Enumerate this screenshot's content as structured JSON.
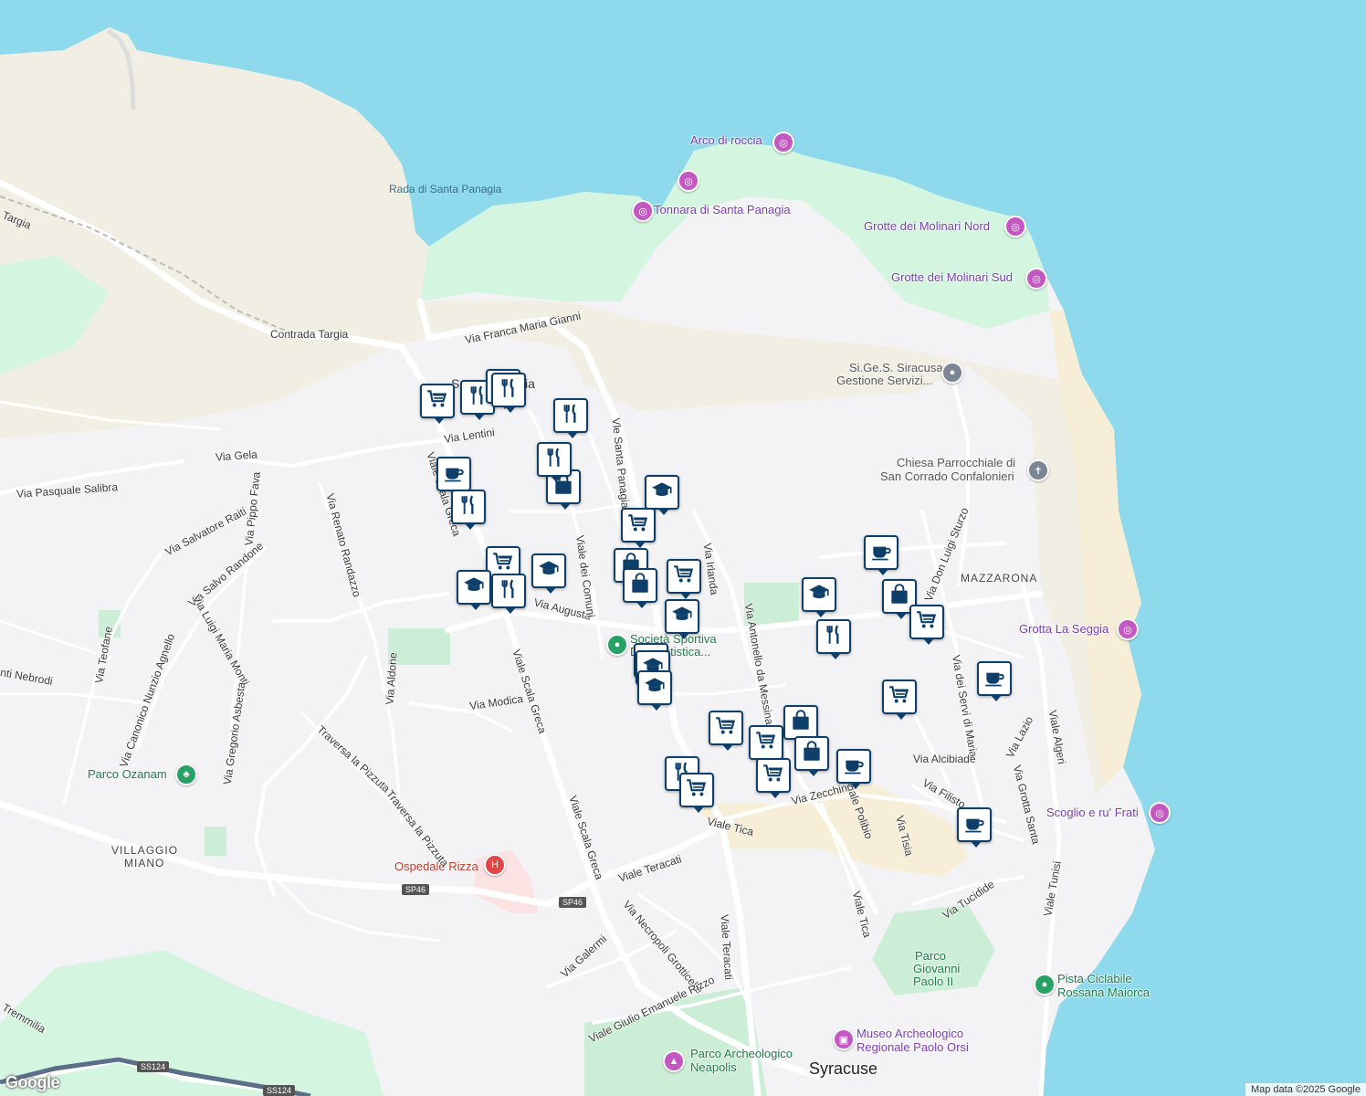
{
  "map": {
    "attribution": "Map data ©2025 Google",
    "logo": "Google",
    "colors": {
      "water": "#8fd9ec",
      "land": "#f3f3f5",
      "park": "#d4f5e0",
      "scrub": "#f1efe3",
      "beach": "#f6eed6",
      "marker_border": "#0d3f6a"
    }
  },
  "labels": {
    "water_rada": "Rada di Santa Panagia",
    "arco": "Arco di roccia",
    "tonnara": "Tonnara di Santa Panagia",
    "molinari_nord": "Grotte dei Molinari Nord",
    "molinari_sud": "Grotte dei Molinari Sud",
    "sigesa_1": "Si.Ge.S. Siracusana",
    "sigesa_2": "Gestione Servizi...",
    "chiesa_1": "Chiesa Parrocchiale di",
    "chiesa_2": "San Corrado Confalonieri",
    "mazzarona": "MAZZARONA",
    "grotta_seggia": "Grotta La Seggia",
    "scoglio": "Scoglio e ru' Frati",
    "pista_1": "Pista Ciclabile",
    "pista_2": "Rossana Maiorca",
    "parco_gp_1": "Parco",
    "parco_gp_2": "Giovanni",
    "parco_gp_3": "Paolo II",
    "museo_1": "Museo Archeologico",
    "museo_2": "Regionale Paolo Orsi",
    "parco_arch_1": "Parco Archeologico",
    "parco_arch_2": "Neapolis",
    "syracuse": "Syracuse",
    "parco_ozanam": "Parco Ozanam",
    "villaggio_1": "VILLAGGIO",
    "villaggio_2": "MIANO",
    "ospedale": "Ospedale Rizza",
    "societa_1": "Società Sportiva",
    "societa_2": "Dilettantistica...",
    "santa_panagia": "Santa Panagia",
    "sp46": "SP46",
    "ss124": "SS124",
    "targia": "Targia",
    "contrada_targia": "Contrada Targia",
    "via_franca": "Via Franca Maria Gianni",
    "via_lentini": "Via Lentini",
    "via_gela": "Via Gela",
    "via_pasquale": "Via Pasquale Salibra",
    "via_pippo": "Via Pippo Fava",
    "via_renato": "Via Renato Randazzo",
    "via_salvatore": "Via Salvatore Raiti",
    "via_salvo": "Via Salvo Randone",
    "via_luigi": "Via Luigi Maria Monti",
    "via_teofane": "Via Teofane",
    "via_nebrodi": "nti Nebrodi",
    "via_canonico": "Via Canonico Nunzio Agnello",
    "via_gregorio": "Via Gregorio Asbesta",
    "via_aldone": "Via Aldone",
    "via_modica": "Via Modica",
    "traversa_1": "Traversa la Pizzuta",
    "traversa_2": "Traversa la Pizzuta",
    "viale_scala": "Viale Scala Greca",
    "viale_scala_2": "Viale Scala Greca",
    "viale_teracati": "Viale Teracati",
    "viale_teracati_2": "Viale Teracati",
    "via_augusta": "Via Augusta",
    "viale_comuni": "Viale dei Comuni",
    "vle_santa": "Vle Santa Panagia",
    "via_irlanda": "Via Irlanda",
    "via_antonello": "Via Antonello da Messina",
    "via_don_luigi": "Via Don Luigi Sturzo",
    "via_servi": "Via dei Servi di Maria",
    "viale_algeri": "Viale Algeri",
    "via_lazio": "Via Lazio",
    "via_grotta": "Via Grotta Santa",
    "via_alcibiade": "Via Alcibiade",
    "via_filisto": "Via Filisto",
    "via_tisia": "Via Tisia",
    "viale_polibio": "Viale Polibio",
    "viale_tica": "Viale Tica",
    "viale_tica_2": "Viale Tica",
    "via_tucidide": "Via Tucidide",
    "viale_tunisi": "Viale Tunisi",
    "via_zecchino": "Via Zecchino",
    "via_necropoli": "Via Necropoli Grotticelle",
    "via_galermi": "Via Galermi",
    "viale_giulio": "Viale Giulio Emanuele Rizzo",
    "tremmilia": "Tremmilia"
  },
  "markers": [
    {
      "type": "grocery-icon"
    },
    {
      "type": "restaurant-icon"
    },
    {
      "type": "restaurant-icon"
    },
    {
      "type": "restaurant-icon"
    },
    {
      "type": "restaurant-icon"
    },
    {
      "type": "cafe-icon"
    },
    {
      "type": "restaurant-icon"
    },
    {
      "type": "shopping-bag-icon"
    },
    {
      "type": "restaurant-icon"
    },
    {
      "type": "school-icon"
    },
    {
      "type": "grocery-icon"
    },
    {
      "type": "grocery-icon"
    },
    {
      "type": "school-icon"
    },
    {
      "type": "school-icon"
    },
    {
      "type": "restaurant-icon"
    },
    {
      "type": "shopping-bag-icon"
    },
    {
      "type": "shopping-bag-icon"
    },
    {
      "type": "grocery-icon"
    },
    {
      "type": "school-icon"
    },
    {
      "type": "school-icon"
    },
    {
      "type": "school-icon"
    },
    {
      "type": "school-icon"
    },
    {
      "type": "grocery-icon"
    },
    {
      "type": "grocery-icon"
    },
    {
      "type": "shopping-bag-icon"
    },
    {
      "type": "shopping-bag-icon"
    },
    {
      "type": "grocery-icon"
    },
    {
      "type": "cafe-icon"
    },
    {
      "type": "restaurant-icon"
    },
    {
      "type": "grocery-icon"
    },
    {
      "type": "school-icon"
    },
    {
      "type": "restaurant-icon"
    },
    {
      "type": "cafe-icon"
    },
    {
      "type": "shopping-bag-icon"
    },
    {
      "type": "grocery-icon"
    },
    {
      "type": "grocery-icon"
    },
    {
      "type": "cafe-icon"
    },
    {
      "type": "cafe-icon"
    }
  ]
}
